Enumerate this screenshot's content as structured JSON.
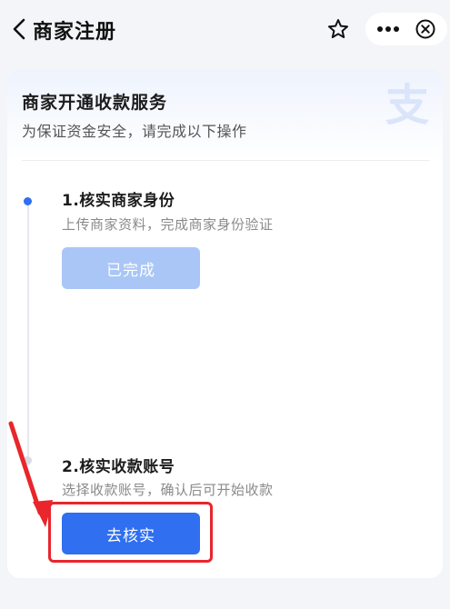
{
  "header": {
    "title": "商家注册",
    "back_icon": "chevron-left-icon",
    "star_icon": "star-icon",
    "more_icon": "more-icon",
    "close_icon": "close-circle-icon"
  },
  "card": {
    "title": "商家开通收款服务",
    "subtitle": "为保证资金安全，请完成以下操作",
    "watermark_icon": "alipay-logo-icon"
  },
  "steps": [
    {
      "title": "1.核实商家身份",
      "description": "上传商家资料，完成商家身份验证",
      "button_label": "已完成",
      "status": "completed"
    },
    {
      "title": "2.核实收款账号",
      "description": "选择收款账号，确认后可开始收款",
      "button_label": "去核实",
      "status": "pending"
    }
  ],
  "colors": {
    "accent": "#2f6ff0",
    "accent_disabled": "#a9c6f6",
    "annotation": "#e8262c"
  }
}
